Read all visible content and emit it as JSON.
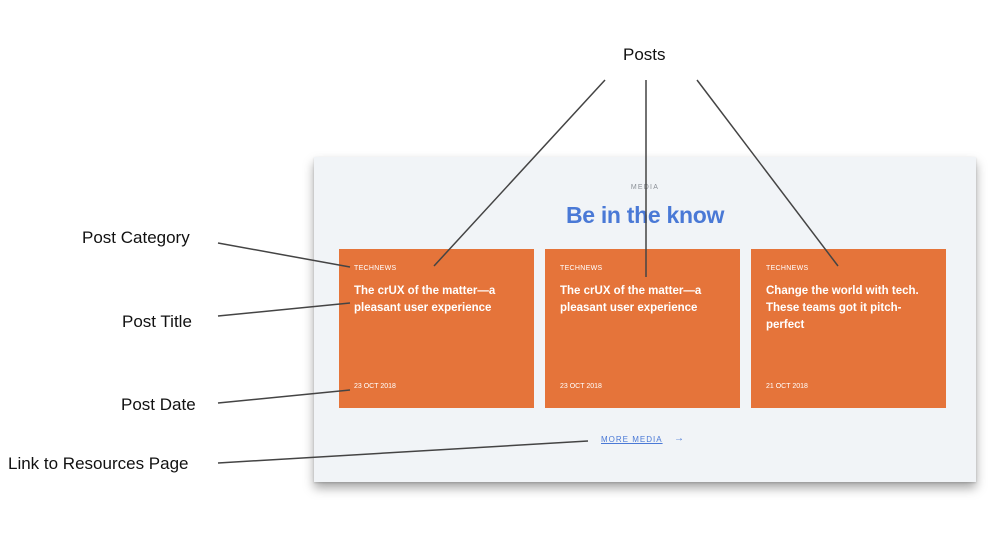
{
  "callouts": {
    "posts": "Posts",
    "category": "Post Category",
    "title": "Post Title",
    "date": "Post Date",
    "link": "Link to Resources Page"
  },
  "section": {
    "eyebrow": "MEDIA",
    "headline": "Be in the know"
  },
  "posts": [
    {
      "category": "TECHNEWS",
      "title": "The crUX of the matter—a pleasant user experience",
      "date": "23 OCT 2018"
    },
    {
      "category": "TECHNEWS",
      "title": "The crUX of the matter—a pleasant user experience",
      "date": "23 OCT 2018"
    },
    {
      "category": "TECHNEWS",
      "title": "Change the world with tech. These teams got it pitch-perfect",
      "date": "21 OCT 2018"
    }
  ],
  "more_link": {
    "label": "MORE MEDIA",
    "arrow": "→"
  },
  "colors": {
    "card": "#e5743a",
    "accent": "#4a79d6",
    "panel": "#f1f4f7",
    "leader_line": "#444444"
  }
}
